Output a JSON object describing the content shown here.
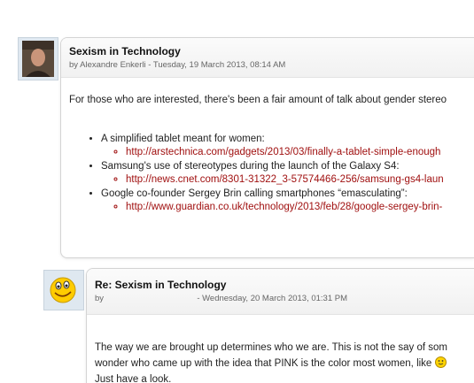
{
  "posts": [
    {
      "subject": "Sexism in Technology",
      "byline": "by Alexandre Enkerli - Tuesday, 19 March 2013, 08:14 AM",
      "intro": "For those who are interested, there's been a fair amount of talk about gender stereo",
      "items": [
        {
          "label": "A simplified tablet meant for women:",
          "url": "http://arstechnica.com/gadgets/2013/03/finally-a-tablet-simple-enough"
        },
        {
          "label": "Samsung's use of stereotypes during the launch of the Galaxy S4:",
          "url": "http://news.cnet.com/8301-31322_3-57574466-256/samsung-gs4-laun"
        },
        {
          "label": "Google co-founder Sergey Brin calling smartphones “emasculating”:",
          "url": "http://www.guardian.co.uk/technology/2013/feb/28/google-sergey-brin-"
        }
      ]
    },
    {
      "subject": "Re: Sexism in Technology",
      "byline_prefix": "by",
      "byline_date": "- Wednesday, 20 March 2013, 01:31 PM",
      "line1": "The way we are brought up determines who we are. This is not the say of som",
      "line2": "wonder who came up with the idea that PINK is the color most women, like",
      "line3": "Just have a look."
    }
  ],
  "icons": {
    "avatar_1": "user-photo-avatar",
    "avatar_2": "smiley-avatar",
    "inline_emoji": "smiley-emoji-icon"
  },
  "colors": {
    "link": "#a01010",
    "avatar_bg": "#dfe8f0"
  }
}
